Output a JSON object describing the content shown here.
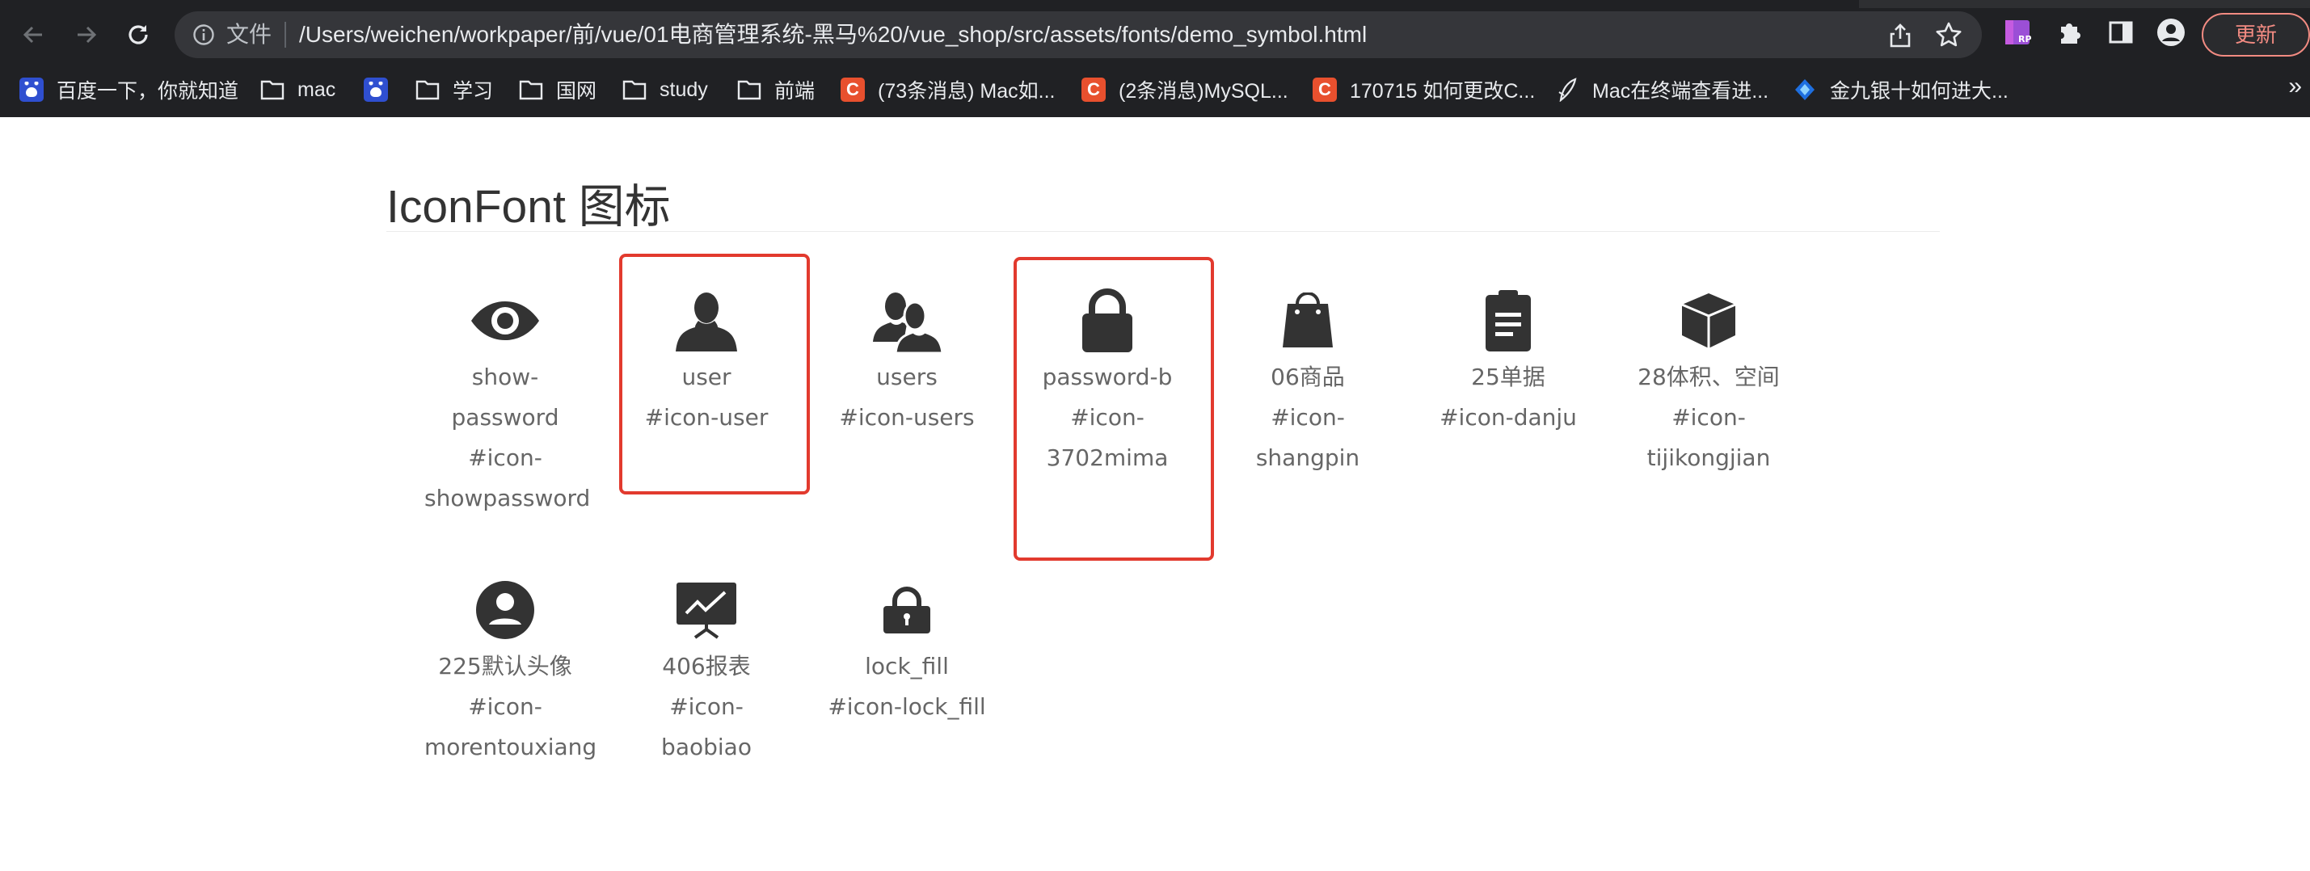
{
  "browser": {
    "omnibox": {
      "scheme_label": "文件",
      "url": "/Users/weichen/workpaper/前/vue/01电商管理系统-黑马%20/vue_shop/src/assets/fonts/demo_symbol.html"
    },
    "update_label": "更新",
    "bookmarks": [
      {
        "label": "百度一下，你就知道",
        "icon": "baidu-icon"
      },
      {
        "label": "mac",
        "icon": "folder-icon"
      },
      {
        "label": "",
        "icon": "baidu-icon"
      },
      {
        "label": "学习",
        "icon": "folder-icon"
      },
      {
        "label": "国网",
        "icon": "folder-icon"
      },
      {
        "label": "study",
        "icon": "folder-icon"
      },
      {
        "label": "前端",
        "icon": "folder-icon"
      },
      {
        "label": "(73条消息) Mac如...",
        "icon": "csdn-icon"
      },
      {
        "label": "(2条消息)MySQL...",
        "icon": "csdn-icon"
      },
      {
        "label": "170715 如何更改C...",
        "icon": "csdn-icon"
      },
      {
        "label": "Mac在终端查看进...",
        "icon": "feather-icon"
      },
      {
        "label": "金九银十如何进大...",
        "icon": "diamond-icon"
      }
    ],
    "bookmarks_overflow": "»",
    "colors": {
      "chrome_bg": "#202124",
      "omnibox_bg": "#35363a",
      "update_accent": "#f28b82"
    }
  },
  "page": {
    "title": "IconFont 图标",
    "highlight_color": "#e23a2e",
    "icons": [
      {
        "name": "show-password",
        "code_l1": "#icon-",
        "code_l2": "showpassword",
        "glyph": "eye-icon"
      },
      {
        "name": "user",
        "code_l1": "#icon-user",
        "code_l2": "",
        "glyph": "user-icon",
        "highlighted": true
      },
      {
        "name": "users",
        "code_l1": "#icon-users",
        "code_l2": "",
        "glyph": "users-icon"
      },
      {
        "name": "password-b",
        "code_l1": "#icon-",
        "code_l2": "3702mima",
        "glyph": "lock-icon",
        "highlighted": true
      },
      {
        "name": "06商品",
        "code_l1": "#icon-shangpin",
        "code_l2": "",
        "glyph": "shopping-bag-icon"
      },
      {
        "name": "25单据",
        "code_l1": "#icon-danju",
        "code_l2": "",
        "glyph": "clipboard-icon"
      },
      {
        "name": "28体积、空间",
        "code_l1": "#icon-",
        "code_l2": "tijikongjian",
        "glyph": "cube-icon"
      },
      {
        "name": "225默认头像",
        "code_l1": "#icon-",
        "code_l2": "morentouxiang",
        "glyph": "avatar-icon"
      },
      {
        "name": "406报表",
        "code_l1": "#icon-baobiao",
        "code_l2": "",
        "glyph": "chart-board-icon"
      },
      {
        "name": "lock_fill",
        "code_l1": "#icon-lock_fill",
        "code_l2": "",
        "glyph": "lock-fill-icon"
      }
    ]
  }
}
